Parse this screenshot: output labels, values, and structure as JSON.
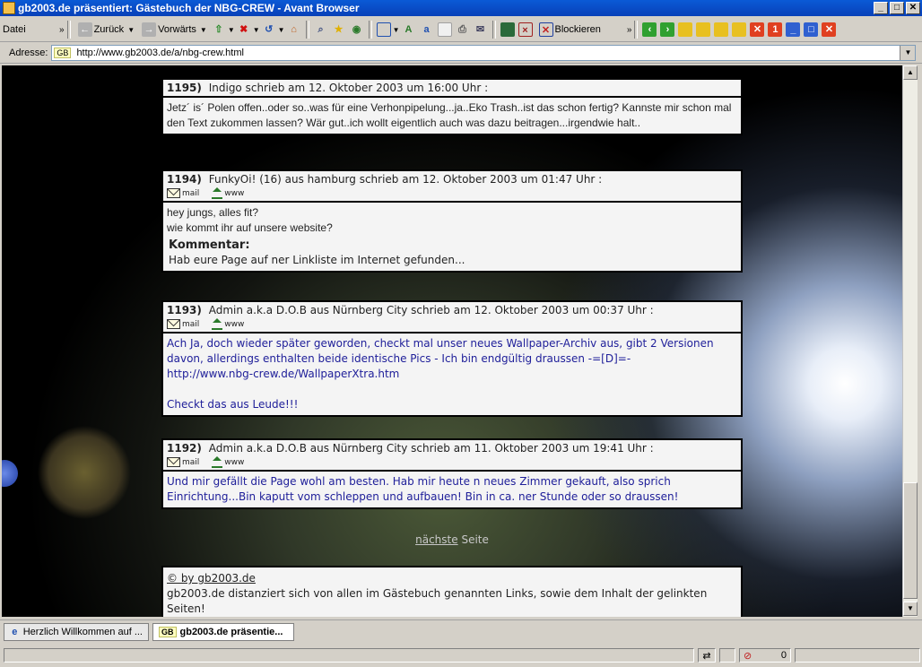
{
  "window": {
    "title": "gb2003.de präsentiert: Gästebuch der NBG-CREW - Avant Browser"
  },
  "menu": {
    "file": "Datei"
  },
  "nav": {
    "back_label": "Zurück",
    "forward_label": "Vorwärts",
    "block_label": "Blockieren"
  },
  "address": {
    "label": "Adresse:",
    "site_badge": "GB",
    "url": "http://www.gb2003.de/a/nbg-crew.html"
  },
  "entries": [
    {
      "number": "1195)",
      "header": "Indigo schrieb am 12. Oktober 2003 um 16:00 Uhr :",
      "body": "Jetz´ is´ Polen offen..oder so..was für eine Verhonpipelung...ja..Eko Trash..ist das schon fertig? Kannste mir schon mal den Text zukommen lassen? Wär gut..ich wollt eigentlich auch was dazu beitragen...irgendwie halt.."
    },
    {
      "number": "1194)",
      "header": "FunkyOi! (16) aus hamburg schrieb am 12. Oktober 2003 um 01:47 Uhr :",
      "mail": "mail",
      "www": "www",
      "body_line1": "hey jungs, alles fit?",
      "body_line2": "wie kommt ihr auf unsere website?",
      "comment_label": "Kommentar:",
      "comment": "Hab eure Page auf ner Linkliste im Internet gefunden..."
    },
    {
      "number": "1193)",
      "header": "Admin a.k.a D.O.B aus Nürnberg City schrieb am 12. Oktober 2003 um 00:37 Uhr :",
      "mail": "mail",
      "www": "www",
      "body_line1": "Ach Ja, doch wieder später geworden, checkt mal unser neues Wallpaper-Archiv aus, gibt 2 Versionen davon, allerdings enthalten beide identische Pics - Ich bin endgültig draussen -=[D]=-",
      "body_link": "http://www.nbg-crew.de/WallpaperXtra.htm",
      "body_line2": "Checkt das aus Leude!!!"
    },
    {
      "number": "1192)",
      "header": "Admin a.k.a D.O.B aus Nürnberg City schrieb am 11. Oktober 2003 um 19:41 Uhr :",
      "mail": "mail",
      "www": "www",
      "body": "Und mir gefällt die Page wohl am besten. Hab mir heute n neues Zimmer gekauft, also sprich Einrichtung...Bin kaputt vom schleppen und aufbauen! Bin in ca. ner Stunde oder so draussen!"
    }
  ],
  "pagination": {
    "next_a": "nächste",
    "next_b": "Seite"
  },
  "footer": {
    "copyright": "© by gb2003.de",
    "disclaimer": "gb2003.de distanziert sich von allen im Gästebuch genannten Links, sowie dem Inhalt der gelinkten Seiten!"
  },
  "tabs": [
    {
      "label": "Herzlich Willkommen auf ..."
    },
    {
      "badge": "GB",
      "label": "gb2003.de präsentie..."
    }
  ],
  "status": {
    "count": "0"
  }
}
